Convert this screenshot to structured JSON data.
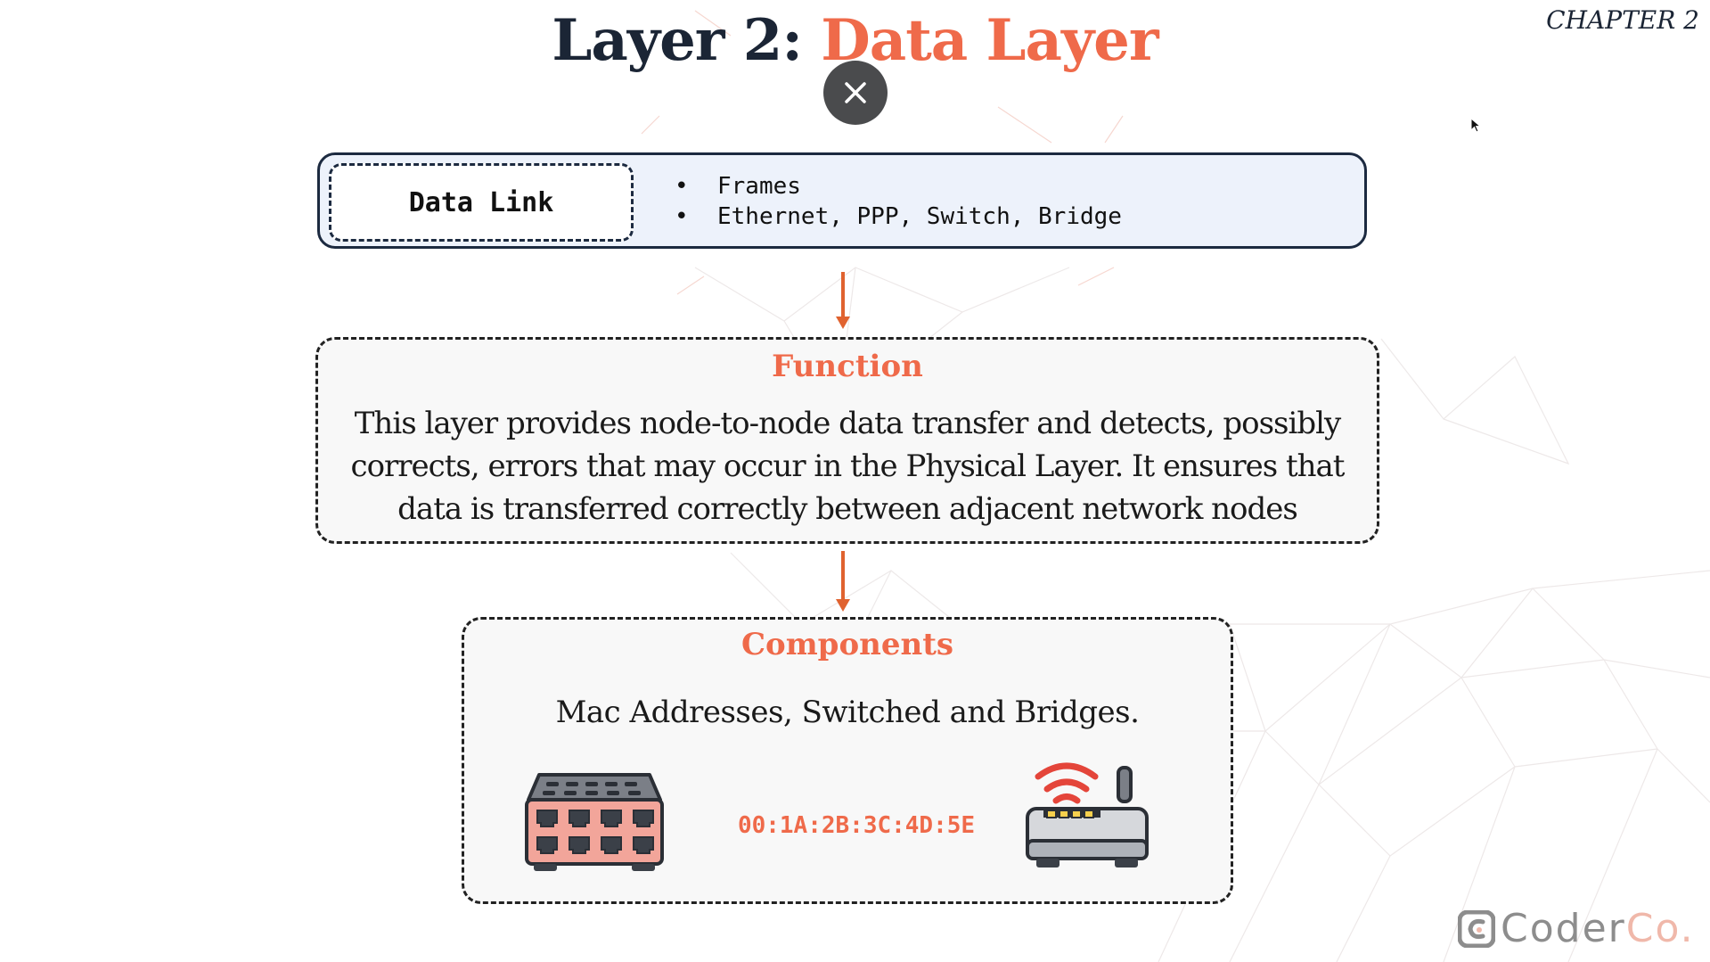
{
  "slide": {
    "title_prefix": "Layer 2: ",
    "title_accent": "Data Layer",
    "chapter": "CHAPTER 2"
  },
  "data_link": {
    "label": "Data Link",
    "bullets": [
      "Frames",
      "Ethernet, PPP, Switch, Bridge"
    ]
  },
  "function": {
    "title": "Function",
    "body": "This layer provides node-to-node data transfer and detects, possibly corrects, errors that may occur in the Physical Layer. It ensures that data is transferred correctly between adjacent network nodes"
  },
  "components": {
    "title": "Components",
    "body": "Mac Addresses, Switched and Bridges.",
    "mac_address": "00:1A:2B:3C:4D:5E",
    "icons": [
      "network-switch-icon",
      "wifi-router-icon"
    ]
  },
  "brand": {
    "name_main": "Coder",
    "name_accent": "Co."
  },
  "colors": {
    "accent": "#ef6a4a",
    "navy": "#1b2535",
    "panel_bg": "#edf2fb",
    "close_button": "#4a4b4d"
  }
}
